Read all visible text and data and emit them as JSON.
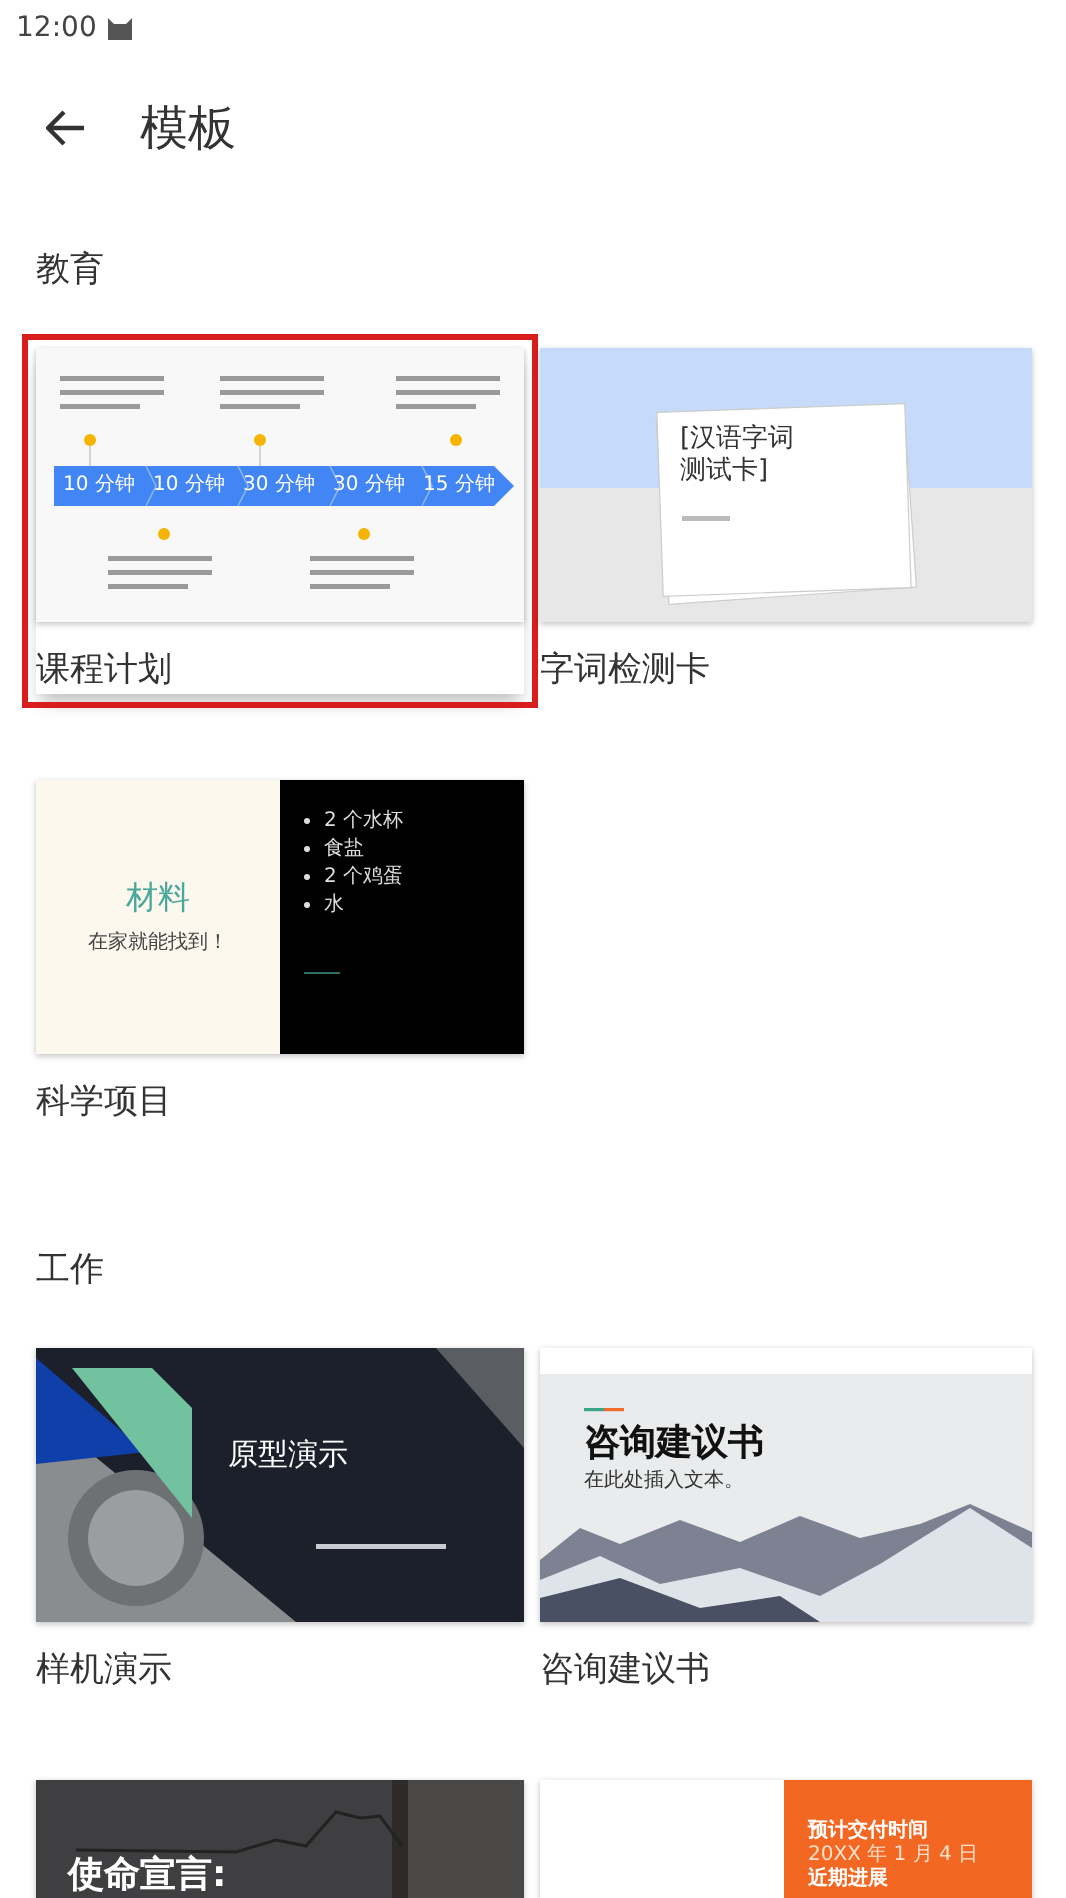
{
  "status_bar": {
    "time": "12:00"
  },
  "app_bar": {
    "title": "模板"
  },
  "sections": [
    {
      "title": "教育",
      "templates": [
        {
          "name": "课程计划",
          "selected": true,
          "kind": "timeline",
          "preview": {
            "steps": [
              "10 分钟",
              "10 分钟",
              "30 分钟",
              "30 分钟",
              "15 分钟"
            ]
          }
        },
        {
          "name": "字词检测卡",
          "selected": false,
          "kind": "flashcard",
          "preview": {
            "title": "[汉语字词测试卡]"
          }
        },
        {
          "name": "科学项目",
          "selected": false,
          "kind": "materials",
          "preview": {
            "title": "材料",
            "subtitle": "在家就能找到！",
            "bullets": [
              "2 个水杯",
              "食盐",
              "2 个鸡蛋",
              "水"
            ]
          }
        }
      ]
    },
    {
      "title": "工作",
      "templates": [
        {
          "name": "样机演示",
          "selected": false,
          "kind": "prototype",
          "preview": {
            "title": "原型演示"
          }
        },
        {
          "name": "咨询建议书",
          "selected": false,
          "kind": "proposal",
          "preview": {
            "title": "咨询建议书",
            "subtitle": "在此处插入文本。"
          }
        },
        {
          "selected": false,
          "kind": "mission",
          "preview": {
            "title": "使命宣言:"
          }
        },
        {
          "selected": false,
          "kind": "delivery",
          "preview": {
            "heading": "预计交付时间",
            "date": "20XX 年 1 月 4 日",
            "subheading": "近期进展"
          }
        }
      ]
    }
  ]
}
